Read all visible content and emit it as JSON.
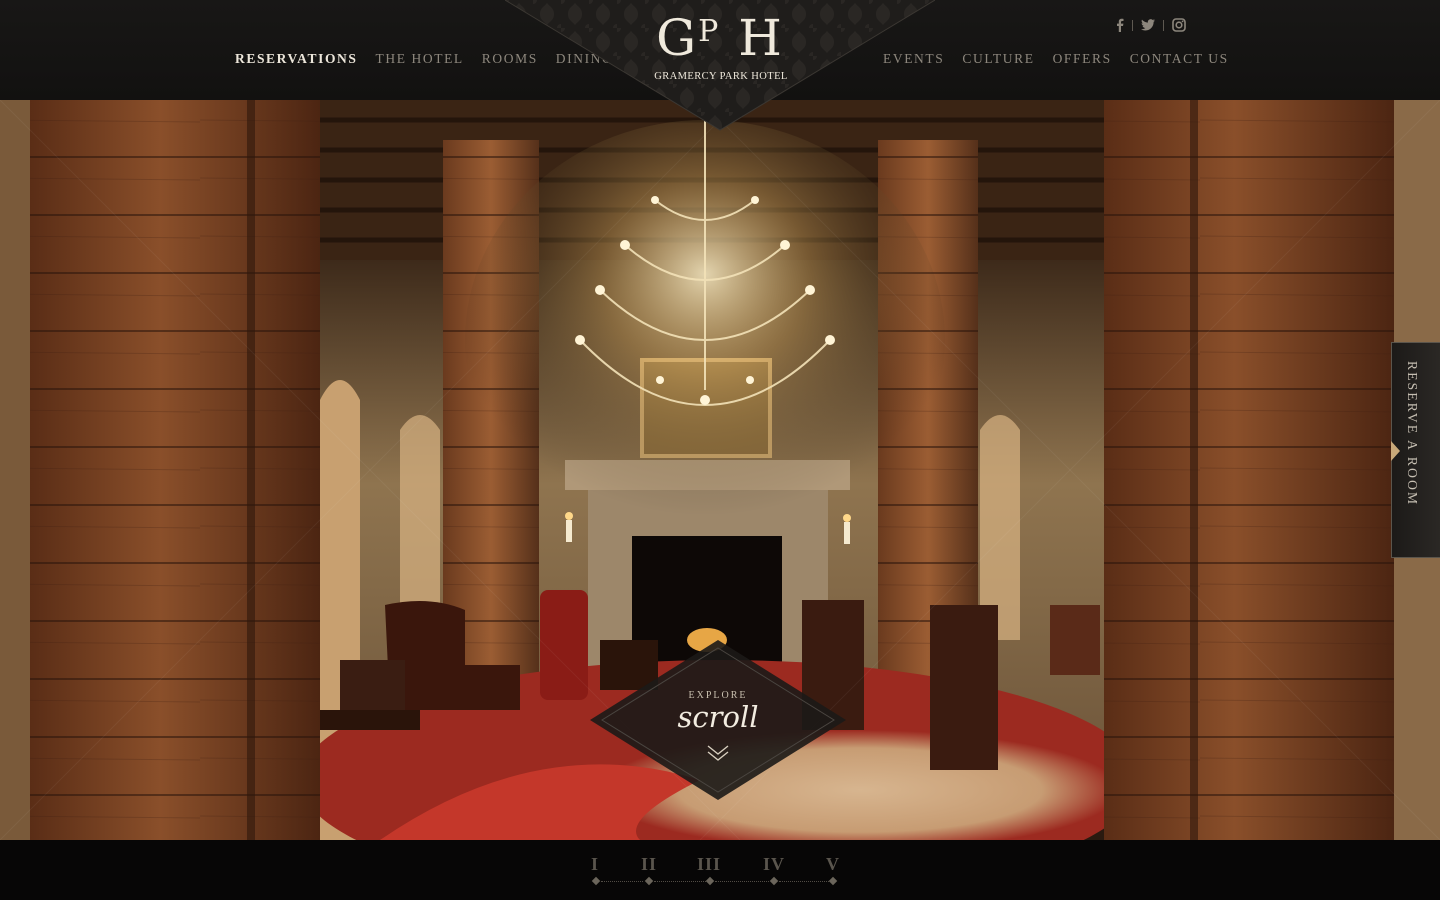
{
  "brand": {
    "monogram_g": "G",
    "monogram_p": "P",
    "monogram_h": "H",
    "name": "GRAMERCY PARK HOTEL"
  },
  "nav_left": [
    "RESERVATIONS",
    "THE HOTEL",
    "ROOMS",
    "DINING"
  ],
  "nav_right": [
    "EVENTS",
    "CULTURE",
    "OFFERS",
    "CONTACT US"
  ],
  "social": [
    "facebook-icon",
    "twitter-icon",
    "instagram-icon"
  ],
  "hero": {
    "alt": "Hotel lobby with wooden pillars, chandelier and fireplace"
  },
  "reserve_tab": {
    "label": "RESERVE A ROOM"
  },
  "explore": {
    "label": "EXPLORE",
    "action": "scroll"
  },
  "pager": [
    "I",
    "II",
    "III",
    "IV",
    "V"
  ],
  "colors": {
    "header_bg": "#151413",
    "accent_gold": "#c9a979",
    "nav_active": "#ece6da",
    "nav_inactive": "#8d877d"
  }
}
